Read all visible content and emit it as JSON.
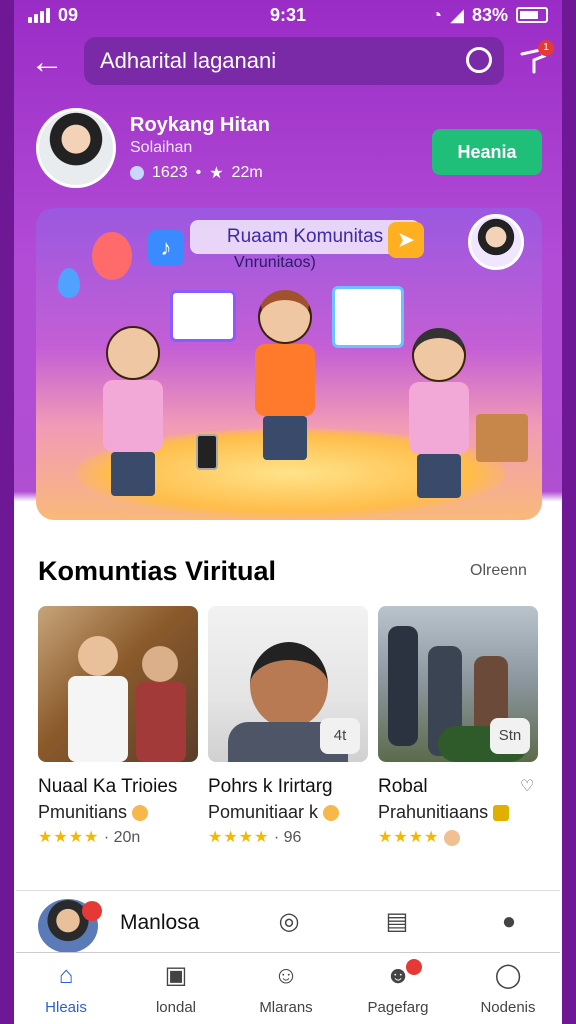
{
  "status": {
    "time": "9:31",
    "carrier": "09",
    "battery": "83%"
  },
  "header": {
    "search_text": "Adharital laganani"
  },
  "profile": {
    "name": "Roykang Hitan",
    "subtitle": "Solaihan",
    "count": "1623",
    "distance": "22m",
    "button": "Heania"
  },
  "banner": {
    "title": "Ruaam Komunitas",
    "subtitle": "Vnrunitaos)"
  },
  "section": {
    "title": "Komuntias Viritual",
    "link": "Olreenn"
  },
  "cards": [
    {
      "name": "Nuaal Ka Trioies",
      "desc": "Pmunitians",
      "rating": "20n",
      "chip": ""
    },
    {
      "name": "Pohrs k Irirtarg",
      "desc": "Pomunitiaar k",
      "rating": "96",
      "chip": "4t"
    },
    {
      "name": "Robal",
      "desc": "Prahunitiaans",
      "rating": "",
      "chip": "Stn"
    }
  ],
  "mini": {
    "label": "Manlosa"
  },
  "nav": [
    {
      "label": "Hleais",
      "icon": "home-icon"
    },
    {
      "label": "londal",
      "icon": "list-icon"
    },
    {
      "label": "Mlarans",
      "icon": "chat-icon"
    },
    {
      "label": "Pagefarg",
      "icon": "emoji-icon"
    },
    {
      "label": "Nodenis",
      "icon": "user-icon"
    }
  ]
}
